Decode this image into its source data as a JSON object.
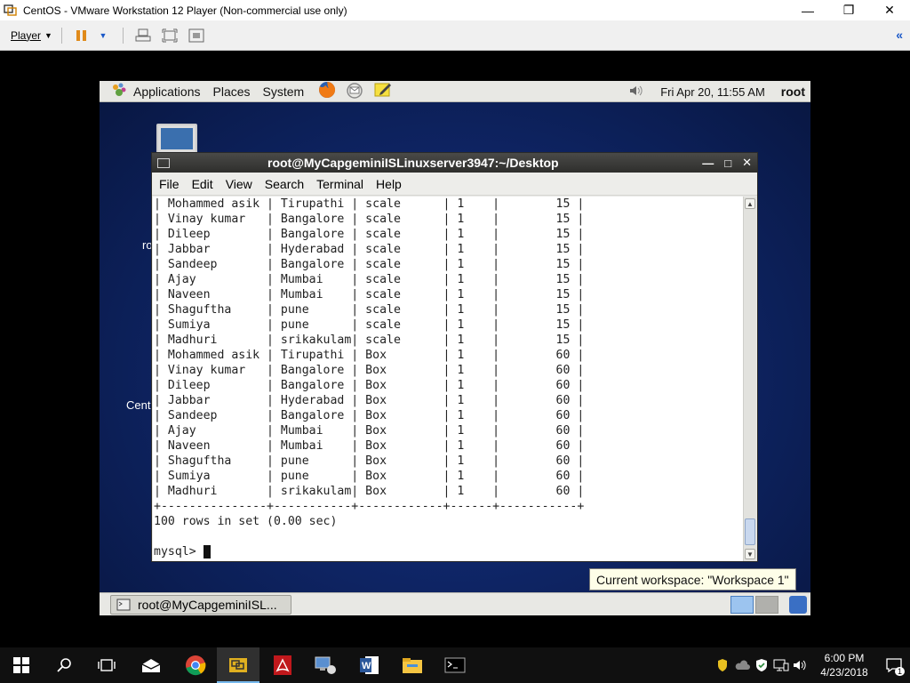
{
  "host_window": {
    "title": "CentOS - VMware Workstation 12 Player (Non-commercial use only)",
    "controls": [
      "minimize-icon",
      "maximize-icon",
      "close-icon"
    ]
  },
  "host_toolbar": {
    "player_label": "Player",
    "buttons": [
      "pause-icon",
      "send-ctrl-alt-del-icon",
      "full-screen-icon",
      "unity-icon"
    ]
  },
  "guest_top_panel": {
    "menus": [
      "Applications",
      "Places",
      "System"
    ],
    "launchers": [
      "firefox-icon",
      "mail-icon",
      "notes-icon"
    ],
    "volume_icon": "volume-icon",
    "clock": "Fri Apr 20, 11:55 AM",
    "user": "root"
  },
  "desktop": {
    "fragments": [
      "ro",
      "Cent"
    ]
  },
  "terminal": {
    "title": "root@MyCapgeminiISLinuxserver3947:~/Desktop",
    "menu": [
      "File",
      "Edit",
      "View",
      "Search",
      "Terminal",
      "Help"
    ],
    "table_rows": [
      [
        "Mohammed asik",
        "Tirupathi",
        "scale",
        "1",
        "15"
      ],
      [
        "Vinay kumar",
        "Bangalore",
        "scale",
        "1",
        "15"
      ],
      [
        "Dileep",
        "Bangalore",
        "scale",
        "1",
        "15"
      ],
      [
        "Jabbar",
        "Hyderabad",
        "scale",
        "1",
        "15"
      ],
      [
        "Sandeep",
        "Bangalore",
        "scale",
        "1",
        "15"
      ],
      [
        "Ajay",
        "Mumbai",
        "scale",
        "1",
        "15"
      ],
      [
        "Naveen",
        "Mumbai",
        "scale",
        "1",
        "15"
      ],
      [
        "Shaguftha",
        "pune",
        "scale",
        "1",
        "15"
      ],
      [
        "Sumiya",
        "pune",
        "scale",
        "1",
        "15"
      ],
      [
        "Madhuri",
        "srikakulam",
        "scale",
        "1",
        "15"
      ],
      [
        "Mohammed asik",
        "Tirupathi",
        "Box",
        "1",
        "60"
      ],
      [
        "Vinay kumar",
        "Bangalore",
        "Box",
        "1",
        "60"
      ],
      [
        "Dileep",
        "Bangalore",
        "Box",
        "1",
        "60"
      ],
      [
        "Jabbar",
        "Hyderabad",
        "Box",
        "1",
        "60"
      ],
      [
        "Sandeep",
        "Bangalore",
        "Box",
        "1",
        "60"
      ],
      [
        "Ajay",
        "Mumbai",
        "Box",
        "1",
        "60"
      ],
      [
        "Naveen",
        "Mumbai",
        "Box",
        "1",
        "60"
      ],
      [
        "Shaguftha",
        "pune",
        "Box",
        "1",
        "60"
      ],
      [
        "Sumiya",
        "pune",
        "Box",
        "1",
        "60"
      ],
      [
        "Madhuri",
        "srikakulam",
        "Box",
        "1",
        "60"
      ]
    ],
    "border_line": "+---------------+-----------+------------+------+-----------+",
    "result_line": "100 rows in set (0.00 sec)",
    "prompt": "mysql> "
  },
  "workspace_tooltip": "Current workspace: \"Workspace 1\"",
  "guest_bottom_panel": {
    "task_label": "root@MyCapgeminiISL..."
  },
  "windows_taskbar": {
    "apps": [
      "start-icon",
      "search-icon",
      "task-view-icon",
      "mail-icon",
      "chrome-icon",
      "vmware-icon",
      "acrobat-icon",
      "network-app-icon",
      "word-icon",
      "file-explorer-icon",
      "terminal-icon"
    ],
    "time": "6:00 PM",
    "date": "4/23/2018",
    "notification_count": "1"
  }
}
